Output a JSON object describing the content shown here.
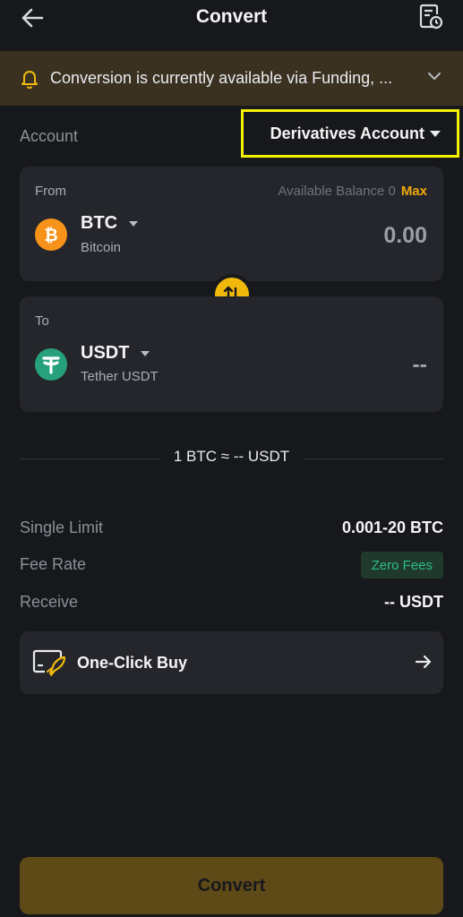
{
  "header": {
    "title": "Convert",
    "back_icon": "arrow-left-icon",
    "history_icon": "order-history-icon"
  },
  "banner": {
    "text": "Conversion is currently available via Funding, ...",
    "icon": "bell-icon",
    "accent": "#f0b90b"
  },
  "account": {
    "label": "Account",
    "selected": "Derivatives Account",
    "highlight": "#f5f000"
  },
  "from": {
    "label": "From",
    "available_label": "Available Balance 0",
    "max_label": "Max",
    "symbol": "BTC",
    "name": "Bitcoin",
    "amount": "0.00",
    "coin_color": "#f7931a"
  },
  "to": {
    "label": "To",
    "symbol": "USDT",
    "name": "Tether USDT",
    "amount": "--",
    "coin_color": "#26a17b"
  },
  "rate": {
    "text": "1 BTC ≈ -- USDT"
  },
  "info": {
    "single_limit_label": "Single Limit",
    "single_limit_value": "0.001-20 BTC",
    "fee_rate_label": "Fee Rate",
    "fee_rate_value": "Zero Fees",
    "receive_label": "Receive",
    "receive_value": "-- USDT"
  },
  "one_click": {
    "label": "One-Click Buy",
    "icon": "rocket-card-icon"
  },
  "convert_button": {
    "label": "Convert",
    "color": "#5e4a16"
  }
}
